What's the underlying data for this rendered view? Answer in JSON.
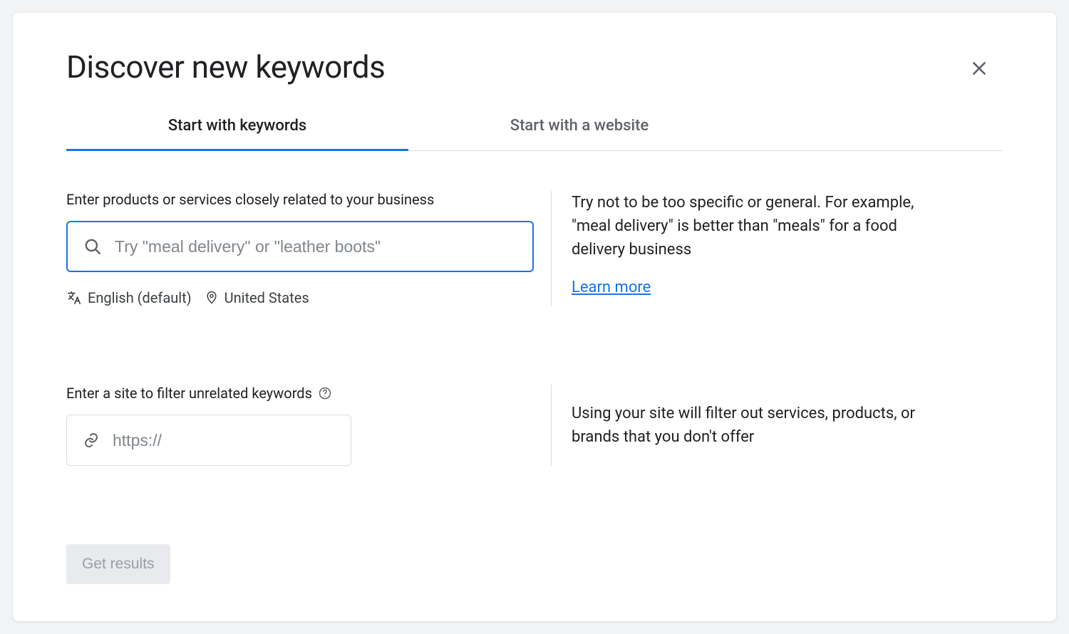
{
  "title": "Discover new keywords",
  "tabs": {
    "keywords": "Start with keywords",
    "website": "Start with a website"
  },
  "keywords_section": {
    "label": "Enter products or services closely related to your business",
    "placeholder": "Try \"meal delivery\" or \"leather boots\"",
    "language": "English (default)",
    "location": "United States",
    "tip": "Try not to be too specific or general. For example, \"meal delivery\" is better than \"meals\" for a food delivery business",
    "learn_more": "Learn more"
  },
  "site_section": {
    "label": "Enter a site to filter unrelated keywords",
    "placeholder": "https://",
    "tip": "Using your site will filter out services, products, or brands that you don't offer"
  },
  "get_results": "Get results"
}
